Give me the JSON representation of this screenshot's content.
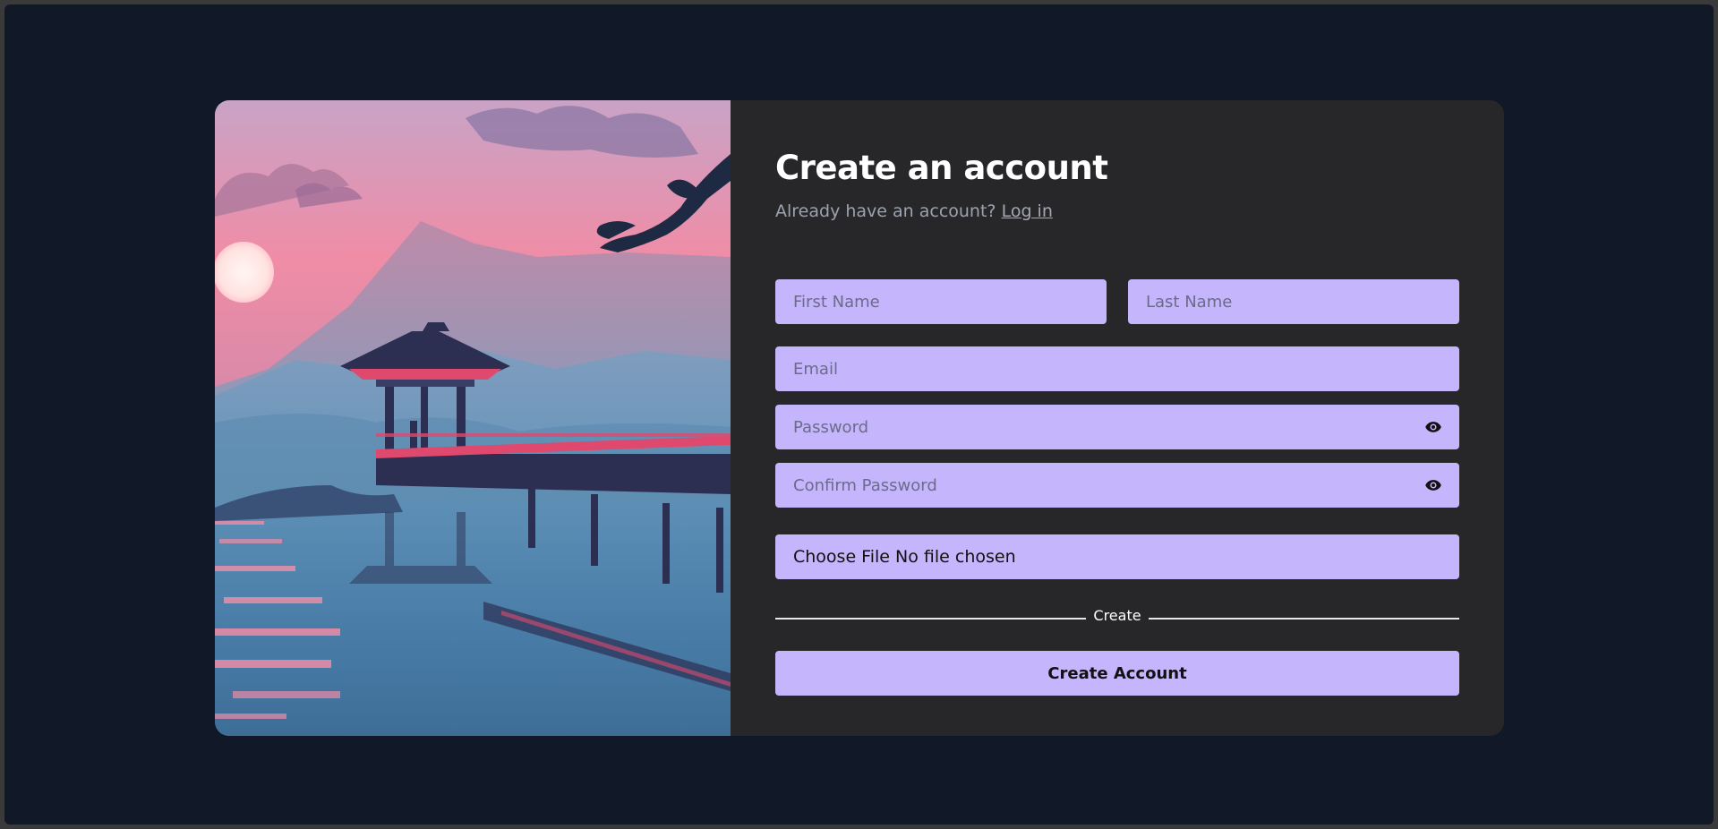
{
  "form": {
    "title": "Create an account",
    "subtitle_text": "Already have an account?",
    "login_link": "Log in",
    "first_name_placeholder": "First Name",
    "last_name_placeholder": "Last Name",
    "email_placeholder": "Email",
    "password_placeholder": "Password",
    "confirm_password_placeholder": "Confirm Password",
    "file_button_label": "Choose File",
    "file_status": "No file chosen",
    "divider_label": "Create",
    "submit_label": "Create Account"
  },
  "icons": {
    "password_toggle": "eye-icon",
    "confirm_password_toggle": "eye-icon"
  },
  "colors": {
    "page_background": "#111827",
    "card_background": "#27272a",
    "input_background": "#c4b5fd",
    "title": "#ffffff",
    "subtitle": "#9ca3af"
  }
}
